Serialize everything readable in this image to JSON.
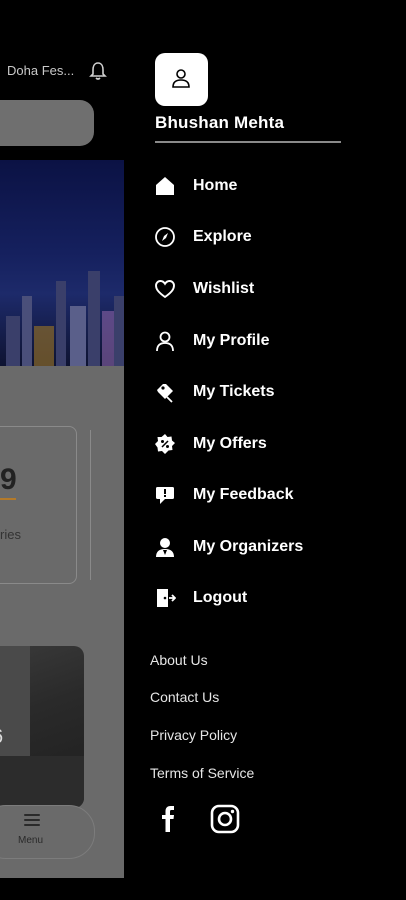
{
  "background_screen": {
    "location_title": "Doha Fes...",
    "stat_number": "9",
    "stat_label": "ries",
    "photo_text": "6",
    "bottom_nav_label": "Menu"
  },
  "drawer": {
    "user_name": "Bhushan Mehta",
    "menu": [
      {
        "label": "Home",
        "icon": "home-icon"
      },
      {
        "label": "Explore",
        "icon": "compass-icon"
      },
      {
        "label": "Wishlist",
        "icon": "heart-icon"
      },
      {
        "label": "My Profile",
        "icon": "user-icon"
      },
      {
        "label": "My Tickets",
        "icon": "ticket-icon"
      },
      {
        "label": "My Offers",
        "icon": "offer-badge-icon"
      },
      {
        "label": "My Feedback",
        "icon": "feedback-icon"
      },
      {
        "label": "My Organizers",
        "icon": "organizer-icon"
      },
      {
        "label": "Logout",
        "icon": "logout-icon"
      }
    ],
    "links": [
      "About Us",
      "Contact Us",
      "Privacy Policy",
      "Terms of Service"
    ],
    "social": [
      "facebook-icon",
      "instagram-icon"
    ]
  }
}
